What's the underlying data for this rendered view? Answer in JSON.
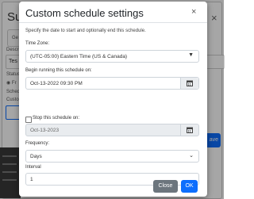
{
  "background": {
    "title": "Sub",
    "close_icon": "×",
    "tab_label": "Ge",
    "desc_label": "Descr",
    "input1_value": "Tes",
    "status_label": "Status",
    "radio_label": "Fr",
    "schedule_label": "Schedule",
    "custom_label": "Custo",
    "save_label": "ave"
  },
  "modal": {
    "title": "Custom schedule settings",
    "close_icon": "×",
    "description": "Specify the date to start and optionally end this schedule.",
    "timezone": {
      "label": "Time Zone:",
      "value": "(UTC-05:00) Eastern Time (US & Canada)"
    },
    "begin": {
      "label": "Begin running this schedule on:",
      "value": "Oct-13-2022 09:30 PM"
    },
    "stop": {
      "checkbox_label": "Stop this schedule on:",
      "checked": false,
      "value": "Oct-13-2023"
    },
    "frequency": {
      "label": "Frequency:",
      "value": "Days"
    },
    "interval": {
      "label": "Interval",
      "value": "1"
    },
    "footer": {
      "close_label": "Close",
      "ok_label": "OK"
    }
  },
  "colors": {
    "primary": "#0d6efd",
    "secondary": "#6c757d",
    "disabled_field": "#e9ecef"
  }
}
